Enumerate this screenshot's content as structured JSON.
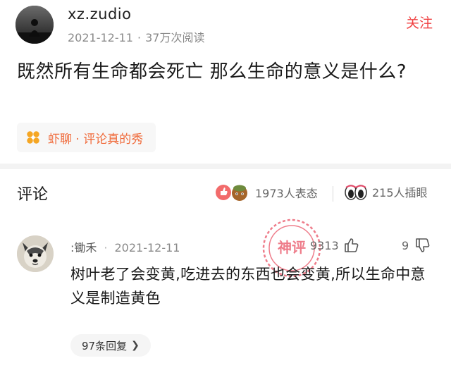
{
  "post": {
    "author": "xz.zudio",
    "date": "2021-12-11",
    "meta_separator": "·",
    "reads": "37万次阅读",
    "follow_label": "关注",
    "title": "既然所有生命都会死亡 那么生命的意义是什么?",
    "tag": "虾聊 · 评论真的秀"
  },
  "comments_header": {
    "title": "评论",
    "reactions": "1973人表态",
    "inserts": "215人插眼"
  },
  "comment": {
    "user": ":锄禾",
    "separator": "·",
    "date": "2021-12-11",
    "likes": "9313",
    "dislikes": "9",
    "text": "树叶老了会变黄,吃进去的东西也会变黄,所以生命中意义是制造黄色",
    "replies": "97条回复",
    "stamp_text": "神评"
  },
  "colors": {
    "follow": "#f04142",
    "tag": "#f06a3a",
    "stamp": "#e8465a"
  },
  "icons": [
    "author-avatar",
    "flower-icon",
    "reaction-emoji-icon",
    "eyes-icon",
    "dog-avatar",
    "thumb-up-icon",
    "thumb-down-icon",
    "chevron-right-icon",
    "stamp-badge"
  ]
}
